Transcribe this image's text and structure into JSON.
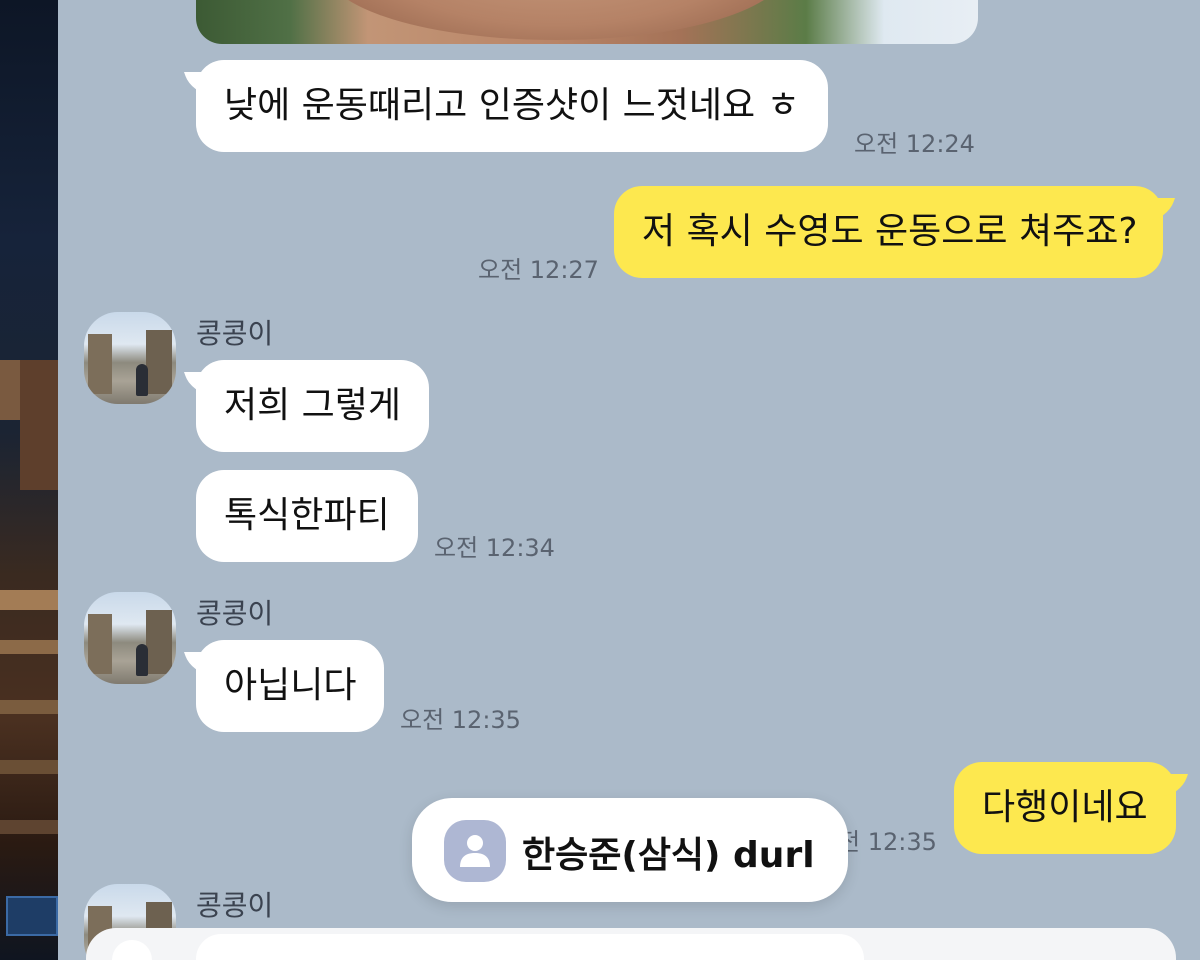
{
  "messages": [
    {
      "id": "m1",
      "text": "낮에 운동때리고 인증샷이 느젓네요 ㅎ",
      "time": "오전 12:24"
    },
    {
      "id": "m2",
      "text": "저 혹시 수영도 운동으로 쳐주죠?",
      "time": "오전 12:27"
    },
    {
      "id": "m3",
      "sender": "콩콩이",
      "text": "저희 그렇게"
    },
    {
      "id": "m4",
      "text": "톡식한파티",
      "time": "오전 12:34"
    },
    {
      "id": "m5",
      "sender": "콩콩이",
      "text": "아닙니다",
      "time": "오전 12:35"
    },
    {
      "id": "m6",
      "text": "다행이네요",
      "time": "12:35",
      "time_partial": "전 12:35"
    },
    {
      "id": "m7",
      "sender": "콩콩이"
    }
  ],
  "mention_popup": {
    "label": "한승준(삼식)  durl",
    "icon": "person-icon"
  },
  "colors": {
    "chat_background": "#abbac9",
    "my_bubble": "#fde84f",
    "other_bubble": "#ffffff",
    "time_text": "#5a6370"
  }
}
